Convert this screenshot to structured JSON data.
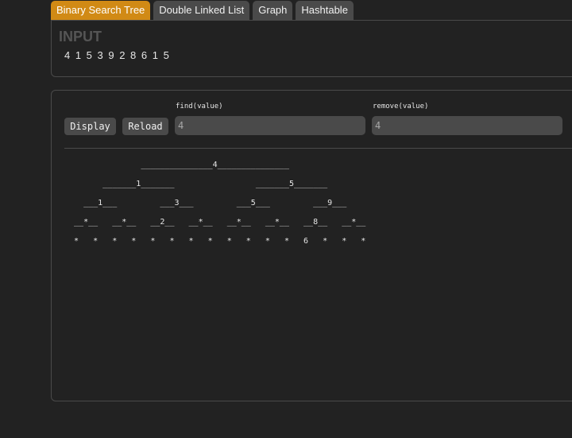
{
  "tabs": [
    {
      "label": "Binary Search Tree",
      "active": true
    },
    {
      "label": "Double Linked List",
      "active": false
    },
    {
      "label": "Graph",
      "active": false
    },
    {
      "label": "Hashtable",
      "active": false
    }
  ],
  "input_panel": {
    "heading": "INPUT",
    "values": "4 1 5 3 9 2 8 6 1 5"
  },
  "controls": {
    "display_label": "Display",
    "reload_label": "Reload",
    "find_label": "find(value)",
    "find_value": "4",
    "remove_label": "remove(value)",
    "remove_value": "4"
  },
  "tree": {
    "lines": [
      "                _______________4_______________",
      "        _______1_______                 _______5_______",
      "    ___1___         ___3___         ___5___         ___9___",
      "  __*__   __*__   __2__   __*__   __*__   __*__   __8__   __*__",
      "  *   *   *   *   *   *   *   *   *   *   *   *   6   *   *   *"
    ]
  },
  "colors": {
    "background": "#222222",
    "active_tab": "#d18a15",
    "inactive_tab": "#4a4a4a",
    "panel_border": "#4a4a4a"
  }
}
